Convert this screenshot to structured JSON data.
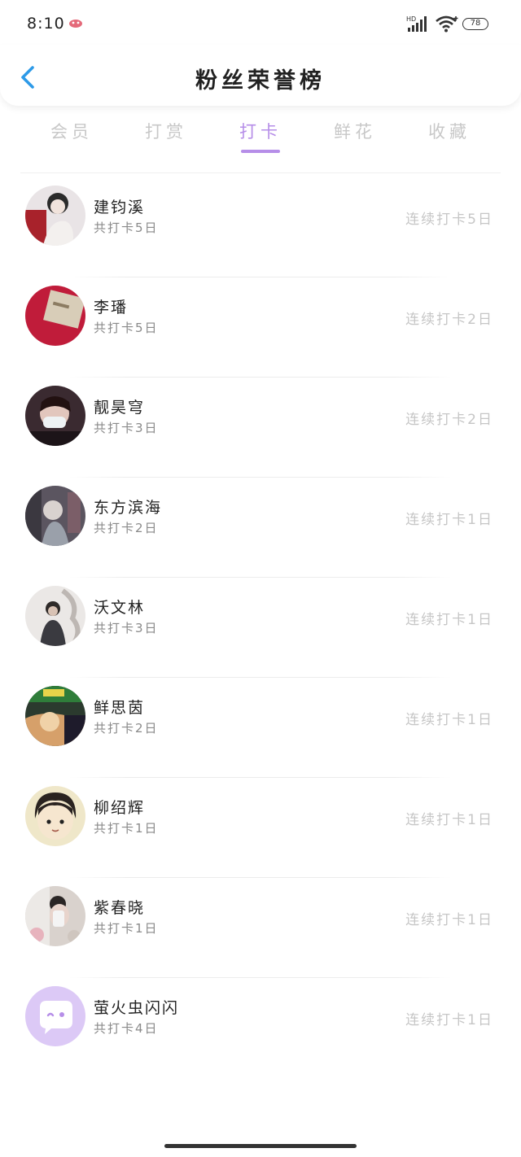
{
  "status_bar": {
    "time": "8:10",
    "battery": "78",
    "network_label": "HD"
  },
  "header": {
    "title": "粉丝荣誉榜",
    "back_icon": "chevron-left-icon"
  },
  "tabs": {
    "items": [
      {
        "label": "会员"
      },
      {
        "label": "打赏"
      },
      {
        "label": "打卡"
      },
      {
        "label": "鲜花"
      },
      {
        "label": "收藏"
      }
    ],
    "active_index": 2
  },
  "colors": {
    "accent": "#b68ee8",
    "back_icon": "#2d9ae8",
    "inactive_tab": "#c8c8c8"
  },
  "fans": [
    {
      "name": "建钧溪",
      "total": "共打卡5日",
      "streak": "连续打卡5日"
    },
    {
      "name": "李璠",
      "total": "共打卡5日",
      "streak": "连续打卡2日"
    },
    {
      "name": "靓昊穹",
      "total": "共打卡3日",
      "streak": "连续打卡2日"
    },
    {
      "name": "东方滨海",
      "total": "共打卡2日",
      "streak": "连续打卡1日"
    },
    {
      "name": "沃文林",
      "total": "共打卡3日",
      "streak": "连续打卡1日"
    },
    {
      "name": "鲜思茵",
      "total": "共打卡2日",
      "streak": "连续打卡1日"
    },
    {
      "name": "柳绍辉",
      "total": "共打卡1日",
      "streak": "连续打卡1日"
    },
    {
      "name": "紫春晓",
      "total": "共打卡1日",
      "streak": "连续打卡1日"
    },
    {
      "name": "萤火虫闪闪",
      "total": "共打卡4日",
      "streak": "连续打卡1日"
    }
  ]
}
